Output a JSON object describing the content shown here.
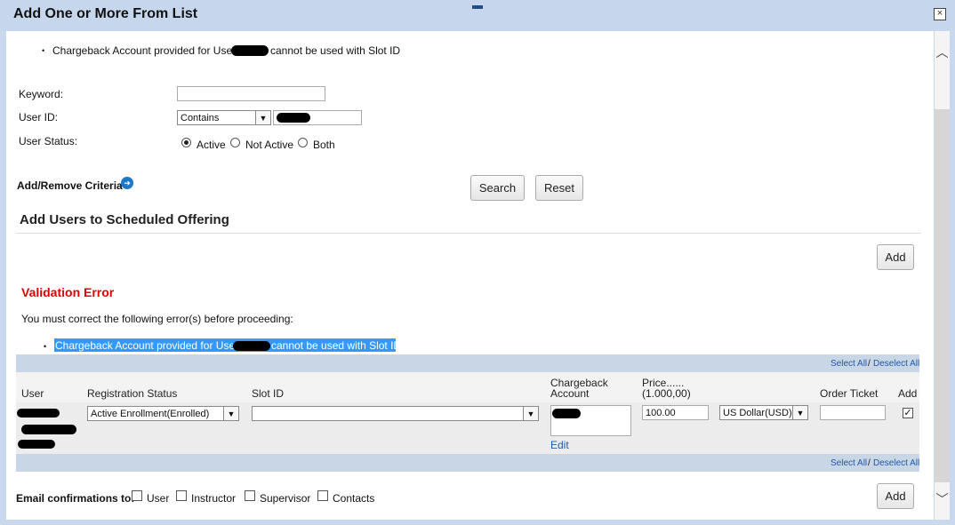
{
  "window": {
    "title": "Add One or More From List",
    "close_glyph": "×"
  },
  "top_message": {
    "before": "Chargeback Account provided for User",
    "after": "cannot be used with Slot ID"
  },
  "search": {
    "keyword_label": "Keyword:",
    "keyword_value": "",
    "userid_label": "User ID:",
    "userid_operator": "Contains",
    "status_label": "User Status:",
    "status_options": [
      "Active",
      "Not Active",
      "Both"
    ],
    "status_selected": "Active",
    "criteria_label": "Add/Remove Criteria",
    "search_button": "Search",
    "reset_button": "Reset"
  },
  "section": {
    "title": "Add Users to Scheduled Offering",
    "add_button": "Add"
  },
  "validation": {
    "title": "Validation Error",
    "subtitle": "You must correct the following error(s) before proceeding:",
    "error_before": "Chargeback Account provided for User",
    "error_after": "cannot be used with Slot ID",
    "error_color": "#e00000",
    "highlight_color": "#3399ff"
  },
  "table": {
    "select_all": "Select All",
    "separator": "/",
    "deselect_all": "Deselect All",
    "headers": {
      "user": "User",
      "registration_status": "Registration Status",
      "slot_id": "Slot ID",
      "chargeback_line1": "Chargeback",
      "chargeback_line2": "Account",
      "price_line1": "Price......",
      "price_line2": "(1.000,00)",
      "order_ticket": "Order Ticket",
      "add": "Add"
    },
    "rows": [
      {
        "registration_status": "Active Enrollment(Enrolled)",
        "slot_id": "",
        "edit_link": "Edit",
        "price": "100.00",
        "currency": "US Dollar(USD)",
        "order_ticket": "",
        "add_checked": "✓"
      }
    ]
  },
  "email": {
    "label": "Email confirmations to:",
    "options": [
      "User",
      "Instructor",
      "Supervisor",
      "Contacts"
    ],
    "add_button": "Add"
  },
  "icons": {
    "criteria": "arrow-circle-right-icon",
    "dropdown": "chevron-down-icon",
    "scroll_up": "chevron-up-icon",
    "scroll_down": "chevron-down-icon"
  },
  "glyphs": {
    "bullet": "•",
    "dropdown": "▼",
    "scroll_up": "︿",
    "scroll_down": "﹀",
    "arrow": "➔"
  }
}
